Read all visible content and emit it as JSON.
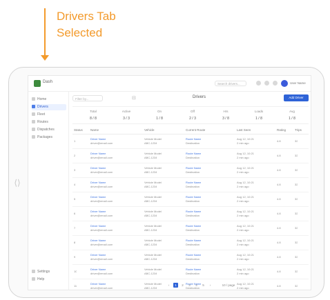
{
  "annotation": {
    "line1": "Drivers Tab",
    "line2": "Selected",
    "color": "#f39a2b"
  },
  "app": {
    "name": "Dash",
    "search_placeholder": "Search drivers...",
    "user_name": "User Name"
  },
  "sidebar": {
    "items": [
      {
        "label": "Home",
        "icon": "home-icon"
      },
      {
        "label": "Drivers",
        "icon": "drivers-icon",
        "active": true
      },
      {
        "label": "Fleet",
        "icon": "truck-icon"
      },
      {
        "label": "Routes",
        "icon": "route-icon"
      },
      {
        "label": "Dispatches",
        "icon": "dispatch-icon"
      },
      {
        "label": "Packages",
        "icon": "package-icon"
      }
    ],
    "bottom": [
      {
        "label": "Settings",
        "icon": "gear-icon"
      },
      {
        "label": "Help",
        "icon": "help-icon"
      }
    ]
  },
  "toolbar": {
    "filter_placeholder": "Filter by...",
    "title": "Drivers",
    "primary_label": "Add Driver"
  },
  "stats": [
    {
      "label": "Total",
      "value": "8 / 8"
    },
    {
      "label": "Active",
      "value": "3 / 3"
    },
    {
      "label": "On",
      "value": "1 / 8"
    },
    {
      "label": "Off",
      "value": "2 / 3"
    },
    {
      "label": "Hrs",
      "value": "3 / 8"
    },
    {
      "label": "Loads",
      "value": "1 / 8"
    },
    {
      "label": "Avg",
      "value": "1 / 8"
    }
  ],
  "table": {
    "headers": [
      "Status",
      "Name",
      "Vehicle",
      "Current Route",
      "Last Seen",
      "Rating",
      "Trips"
    ],
    "rows": [
      {
        "id": "1",
        "name": "Driver Name",
        "name2": "driver@email.com",
        "vehicle": "Vehicle Model",
        "vehicle2": "ABC-1234",
        "route": "Route Name",
        "route2": "Destination",
        "seen": "Aug 12, 10:21",
        "seen2": "2 min ago",
        "rating": "4.8",
        "trips": "32"
      },
      {
        "id": "2",
        "name": "Driver Name",
        "name2": "driver@email.com",
        "vehicle": "Vehicle Model",
        "vehicle2": "ABC-1234",
        "route": "Route Name",
        "route2": "Destination",
        "seen": "Aug 12, 10:21",
        "seen2": "2 min ago",
        "rating": "4.8",
        "trips": "32"
      },
      {
        "id": "3",
        "name": "Driver Name",
        "name2": "driver@email.com",
        "vehicle": "Vehicle Model",
        "vehicle2": "ABC-1234",
        "route": "Route Name",
        "route2": "Destination",
        "seen": "Aug 12, 10:21",
        "seen2": "2 min ago",
        "rating": "4.8",
        "trips": "32"
      },
      {
        "id": "4",
        "name": "Driver Name",
        "name2": "driver@email.com",
        "vehicle": "Vehicle Model",
        "vehicle2": "ABC-1234",
        "route": "Route Name",
        "route2": "Destination",
        "seen": "Aug 12, 10:21",
        "seen2": "2 min ago",
        "rating": "4.8",
        "trips": "32"
      },
      {
        "id": "5",
        "name": "Driver Name",
        "name2": "driver@email.com",
        "vehicle": "Vehicle Model",
        "vehicle2": "ABC-1234",
        "route": "Route Name",
        "route2": "Destination",
        "seen": "Aug 12, 10:21",
        "seen2": "2 min ago",
        "rating": "4.8",
        "trips": "32"
      },
      {
        "id": "6",
        "name": "Driver Name",
        "name2": "driver@email.com",
        "vehicle": "Vehicle Model",
        "vehicle2": "ABC-1234",
        "route": "Route Name",
        "route2": "Destination",
        "seen": "Aug 12, 10:21",
        "seen2": "2 min ago",
        "rating": "4.8",
        "trips": "32"
      },
      {
        "id": "7",
        "name": "Driver Name",
        "name2": "driver@email.com",
        "vehicle": "Vehicle Model",
        "vehicle2": "ABC-1234",
        "route": "Route Name",
        "route2": "Destination",
        "seen": "Aug 12, 10:21",
        "seen2": "2 min ago",
        "rating": "4.8",
        "trips": "32"
      },
      {
        "id": "8",
        "name": "Driver Name",
        "name2": "driver@email.com",
        "vehicle": "Vehicle Model",
        "vehicle2": "ABC-1234",
        "route": "Route Name",
        "route2": "Destination",
        "seen": "Aug 12, 10:21",
        "seen2": "2 min ago",
        "rating": "4.8",
        "trips": "32"
      },
      {
        "id": "9",
        "name": "Driver Name",
        "name2": "driver@email.com",
        "vehicle": "Vehicle Model",
        "vehicle2": "ABC-1234",
        "route": "Route Name",
        "route2": "Destination",
        "seen": "Aug 12, 10:21",
        "seen2": "2 min ago",
        "rating": "4.8",
        "trips": "32"
      },
      {
        "id": "10",
        "name": "Driver Name",
        "name2": "driver@email.com",
        "vehicle": "Vehicle Model",
        "vehicle2": "ABC-1234",
        "route": "Route Name",
        "route2": "Destination",
        "seen": "Aug 12, 10:21",
        "seen2": "2 min ago",
        "rating": "4.8",
        "trips": "32"
      },
      {
        "id": "11",
        "name": "Driver Name",
        "name2": "driver@email.com",
        "vehicle": "Vehicle Model",
        "vehicle2": "ABC-1234",
        "route": "Route Name",
        "route2": "Destination",
        "seen": "Aug 12, 10:21",
        "seen2": "2 min ago",
        "rating": "4.8",
        "trips": "32"
      }
    ]
  },
  "pager": {
    "prev": "‹",
    "pages": [
      "1",
      "2",
      "3",
      "4",
      "5"
    ],
    "next": "›",
    "page_size": "10 / page"
  }
}
